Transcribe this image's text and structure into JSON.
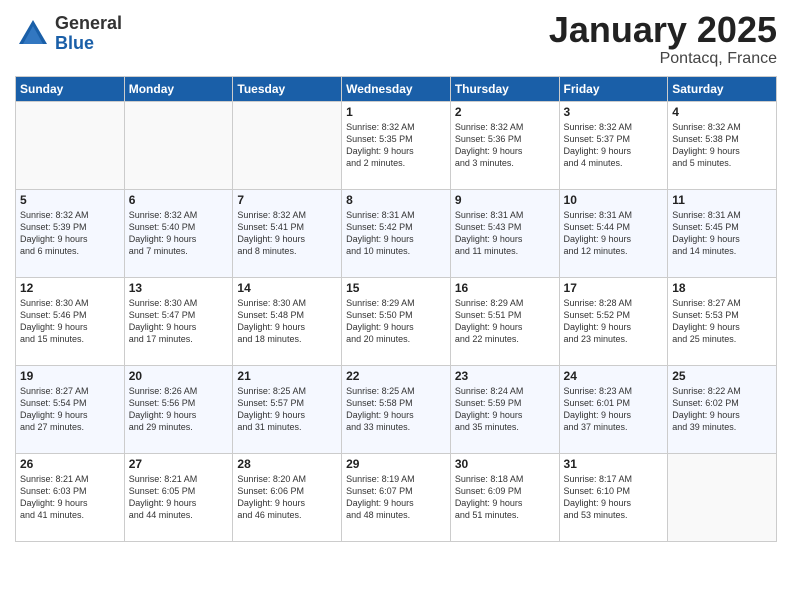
{
  "logo": {
    "general": "General",
    "blue": "Blue"
  },
  "header": {
    "month": "January 2025",
    "location": "Pontacq, France"
  },
  "weekdays": [
    "Sunday",
    "Monday",
    "Tuesday",
    "Wednesday",
    "Thursday",
    "Friday",
    "Saturday"
  ],
  "weeks": [
    [
      {
        "day": "",
        "info": ""
      },
      {
        "day": "",
        "info": ""
      },
      {
        "day": "",
        "info": ""
      },
      {
        "day": "1",
        "info": "Sunrise: 8:32 AM\nSunset: 5:35 PM\nDaylight: 9 hours\nand 2 minutes."
      },
      {
        "day": "2",
        "info": "Sunrise: 8:32 AM\nSunset: 5:36 PM\nDaylight: 9 hours\nand 3 minutes."
      },
      {
        "day": "3",
        "info": "Sunrise: 8:32 AM\nSunset: 5:37 PM\nDaylight: 9 hours\nand 4 minutes."
      },
      {
        "day": "4",
        "info": "Sunrise: 8:32 AM\nSunset: 5:38 PM\nDaylight: 9 hours\nand 5 minutes."
      }
    ],
    [
      {
        "day": "5",
        "info": "Sunrise: 8:32 AM\nSunset: 5:39 PM\nDaylight: 9 hours\nand 6 minutes."
      },
      {
        "day": "6",
        "info": "Sunrise: 8:32 AM\nSunset: 5:40 PM\nDaylight: 9 hours\nand 7 minutes."
      },
      {
        "day": "7",
        "info": "Sunrise: 8:32 AM\nSunset: 5:41 PM\nDaylight: 9 hours\nand 8 minutes."
      },
      {
        "day": "8",
        "info": "Sunrise: 8:31 AM\nSunset: 5:42 PM\nDaylight: 9 hours\nand 10 minutes."
      },
      {
        "day": "9",
        "info": "Sunrise: 8:31 AM\nSunset: 5:43 PM\nDaylight: 9 hours\nand 11 minutes."
      },
      {
        "day": "10",
        "info": "Sunrise: 8:31 AM\nSunset: 5:44 PM\nDaylight: 9 hours\nand 12 minutes."
      },
      {
        "day": "11",
        "info": "Sunrise: 8:31 AM\nSunset: 5:45 PM\nDaylight: 9 hours\nand 14 minutes."
      }
    ],
    [
      {
        "day": "12",
        "info": "Sunrise: 8:30 AM\nSunset: 5:46 PM\nDaylight: 9 hours\nand 15 minutes."
      },
      {
        "day": "13",
        "info": "Sunrise: 8:30 AM\nSunset: 5:47 PM\nDaylight: 9 hours\nand 17 minutes."
      },
      {
        "day": "14",
        "info": "Sunrise: 8:30 AM\nSunset: 5:48 PM\nDaylight: 9 hours\nand 18 minutes."
      },
      {
        "day": "15",
        "info": "Sunrise: 8:29 AM\nSunset: 5:50 PM\nDaylight: 9 hours\nand 20 minutes."
      },
      {
        "day": "16",
        "info": "Sunrise: 8:29 AM\nSunset: 5:51 PM\nDaylight: 9 hours\nand 22 minutes."
      },
      {
        "day": "17",
        "info": "Sunrise: 8:28 AM\nSunset: 5:52 PM\nDaylight: 9 hours\nand 23 minutes."
      },
      {
        "day": "18",
        "info": "Sunrise: 8:27 AM\nSunset: 5:53 PM\nDaylight: 9 hours\nand 25 minutes."
      }
    ],
    [
      {
        "day": "19",
        "info": "Sunrise: 8:27 AM\nSunset: 5:54 PM\nDaylight: 9 hours\nand 27 minutes."
      },
      {
        "day": "20",
        "info": "Sunrise: 8:26 AM\nSunset: 5:56 PM\nDaylight: 9 hours\nand 29 minutes."
      },
      {
        "day": "21",
        "info": "Sunrise: 8:25 AM\nSunset: 5:57 PM\nDaylight: 9 hours\nand 31 minutes."
      },
      {
        "day": "22",
        "info": "Sunrise: 8:25 AM\nSunset: 5:58 PM\nDaylight: 9 hours\nand 33 minutes."
      },
      {
        "day": "23",
        "info": "Sunrise: 8:24 AM\nSunset: 5:59 PM\nDaylight: 9 hours\nand 35 minutes."
      },
      {
        "day": "24",
        "info": "Sunrise: 8:23 AM\nSunset: 6:01 PM\nDaylight: 9 hours\nand 37 minutes."
      },
      {
        "day": "25",
        "info": "Sunrise: 8:22 AM\nSunset: 6:02 PM\nDaylight: 9 hours\nand 39 minutes."
      }
    ],
    [
      {
        "day": "26",
        "info": "Sunrise: 8:21 AM\nSunset: 6:03 PM\nDaylight: 9 hours\nand 41 minutes."
      },
      {
        "day": "27",
        "info": "Sunrise: 8:21 AM\nSunset: 6:05 PM\nDaylight: 9 hours\nand 44 minutes."
      },
      {
        "day": "28",
        "info": "Sunrise: 8:20 AM\nSunset: 6:06 PM\nDaylight: 9 hours\nand 46 minutes."
      },
      {
        "day": "29",
        "info": "Sunrise: 8:19 AM\nSunset: 6:07 PM\nDaylight: 9 hours\nand 48 minutes."
      },
      {
        "day": "30",
        "info": "Sunrise: 8:18 AM\nSunset: 6:09 PM\nDaylight: 9 hours\nand 51 minutes."
      },
      {
        "day": "31",
        "info": "Sunrise: 8:17 AM\nSunset: 6:10 PM\nDaylight: 9 hours\nand 53 minutes."
      },
      {
        "day": "",
        "info": ""
      }
    ]
  ]
}
